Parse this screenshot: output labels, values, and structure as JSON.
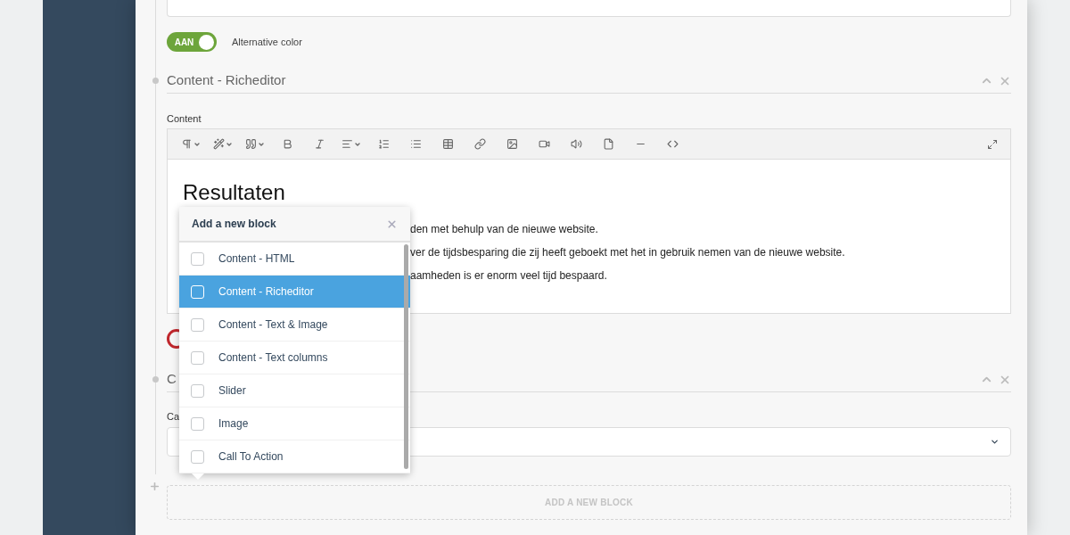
{
  "toggle": {
    "label": "AAN",
    "on": true,
    "caption": "Alternative color"
  },
  "richeditor_block": {
    "title": "Content - Richeditor",
    "field_label": "Content",
    "heading": "Resultaten",
    "paragraphs": [
      "den met behulp van de nieuwe website.",
      "ver de tijdsbesparing die zij heeft geboekt met het in gebruik nemen van de nieuwe website.",
      "aamheden is er enorm veel tijd bespaard."
    ]
  },
  "second_block": {
    "title": "C",
    "field_label": "Ca"
  },
  "add_block_button": "ADD A NEW BLOCK",
  "popup": {
    "title": "Add a new block",
    "items": [
      {
        "label": "Content - HTML",
        "selected": false,
        "checked": false
      },
      {
        "label": "Content - Richeditor",
        "selected": true,
        "checked": false
      },
      {
        "label": "Content - Text & Image",
        "selected": false,
        "checked": false
      },
      {
        "label": "Content - Text columns",
        "selected": false,
        "checked": false
      },
      {
        "label": "Slider",
        "selected": false,
        "checked": false
      },
      {
        "label": "Image",
        "selected": false,
        "checked": false
      },
      {
        "label": "Call To Action",
        "selected": false,
        "checked": false
      }
    ]
  }
}
